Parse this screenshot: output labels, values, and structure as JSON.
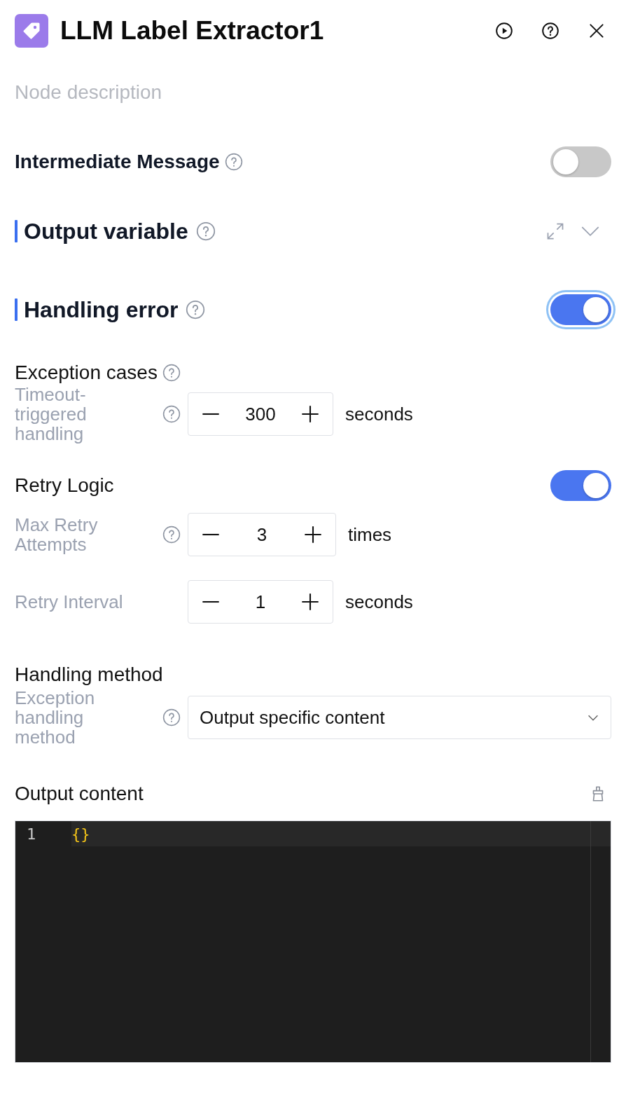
{
  "header": {
    "title": "LLM Label Extractor1",
    "description_placeholder": "Node description"
  },
  "intermediate_message": {
    "label": "Intermediate Message",
    "on": false
  },
  "output_variable": {
    "title": "Output variable"
  },
  "handling_error": {
    "title": "Handling error",
    "on": true,
    "focused": true
  },
  "exception_cases": {
    "label": "Exception cases",
    "fields": [
      {
        "label": "Timeout-triggered handling",
        "value": "300",
        "unit": "seconds",
        "help": true
      }
    ]
  },
  "retry_logic": {
    "label": "Retry Logic",
    "on": true,
    "fields": [
      {
        "label": "Max Retry Attempts",
        "value": "3",
        "unit": "times",
        "help": true
      },
      {
        "label": "Retry Interval",
        "value": "1",
        "unit": "seconds",
        "help": false
      }
    ]
  },
  "handling_method": {
    "label": "Handling method",
    "field_label": "Exception handling method",
    "value": "Output specific content"
  },
  "output_content": {
    "label": "Output content",
    "lines": [
      {
        "number": "1",
        "code": "{}"
      }
    ]
  }
}
